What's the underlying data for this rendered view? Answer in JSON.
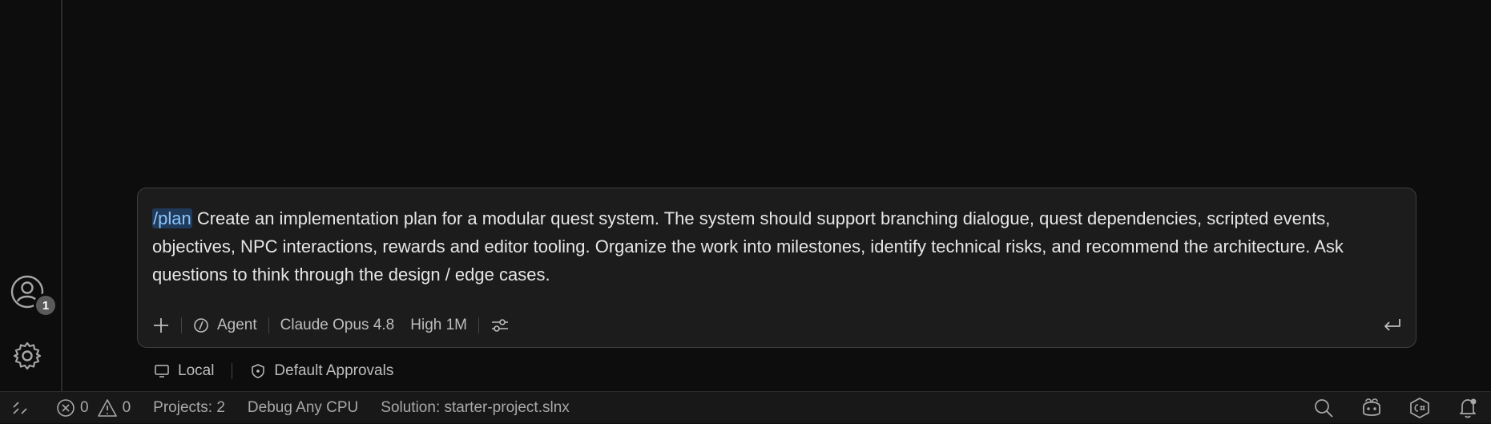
{
  "sidebar": {
    "account_badge": "1"
  },
  "chat": {
    "slash_command": "/plan",
    "prompt_text": " Create an implementation plan for a modular quest system. The system should support branching dialogue, quest dependencies, scripted events, objectives, NPC interactions, rewards and editor tooling. Organize the work into milestones, identify technical risks, and recommend the architecture. Ask questions to think through the design / edge cases.",
    "mode_label": "Agent",
    "model_label": "Claude Opus 4.8",
    "effort_label": "High 1M",
    "location_label": "Local",
    "approvals_label": "Default Approvals"
  },
  "status_bar": {
    "errors": "0",
    "warnings": "0",
    "projects": "Projects: 2",
    "config": "Debug Any CPU",
    "solution": "Solution: starter-project.slnx"
  },
  "icons": {
    "remote": "remote-icon",
    "error": "error-icon",
    "warning": "warning-icon",
    "zoom": "zoom-icon",
    "copilot": "copilot-icon",
    "csharp": "csharp-icon",
    "bell": "bell-icon",
    "account": "account-icon",
    "gear": "gear-icon"
  },
  "colors": {
    "background": "#0d0d0d",
    "chat_box": "#1c1c1c",
    "slash_highlight": "#1f3a5a",
    "slash_text": "#8cc4ff"
  }
}
